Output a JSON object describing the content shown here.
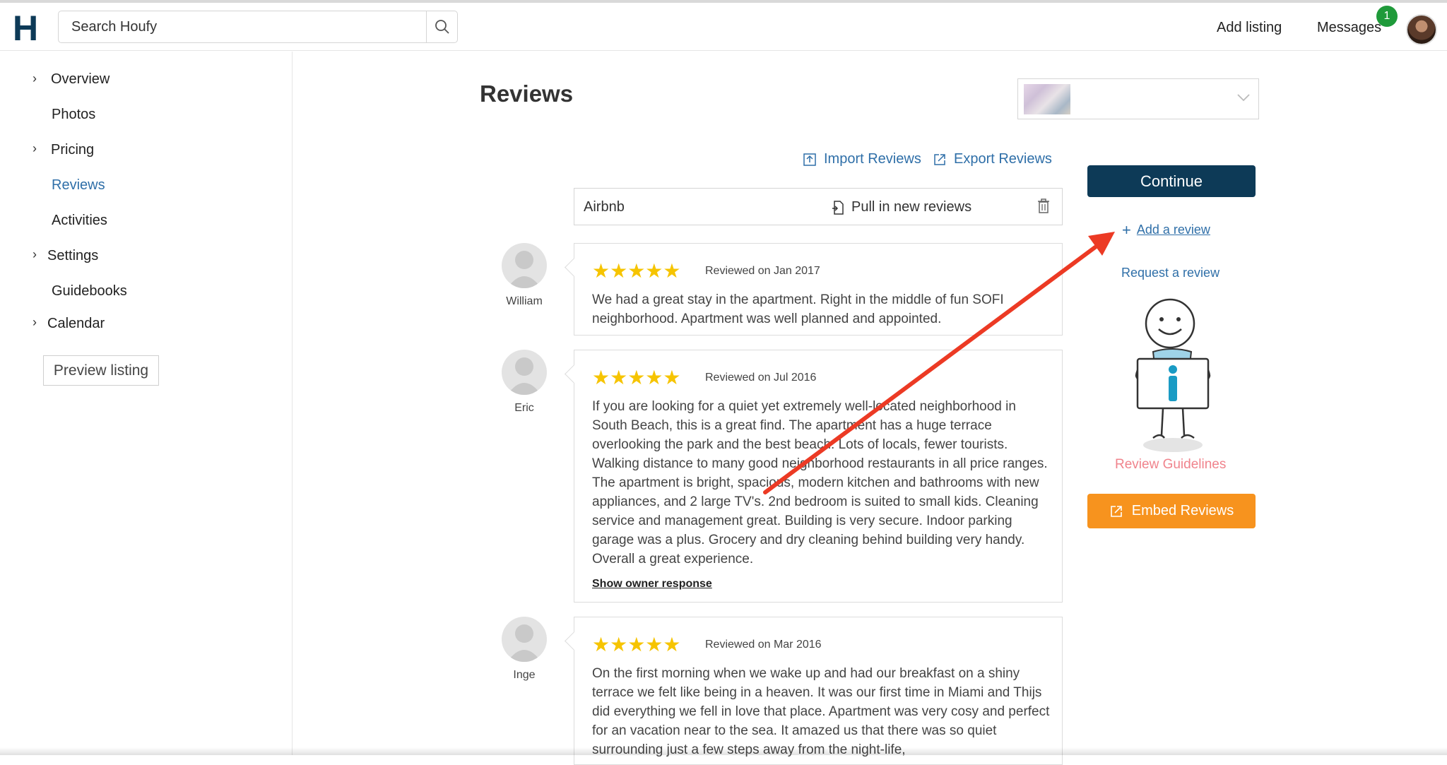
{
  "header": {
    "logo": "H",
    "search_placeholder": "Search Houfy",
    "add_listing": "Add listing",
    "messages": "Messages",
    "messages_badge": "1"
  },
  "sidebar": {
    "items": [
      {
        "label": "Overview",
        "chevron": true
      },
      {
        "label": "Photos",
        "chevron": false
      },
      {
        "label": "Pricing",
        "chevron": true
      },
      {
        "label": "Reviews",
        "chevron": false,
        "active": true
      },
      {
        "label": "Activities",
        "chevron": false
      },
      {
        "label": "Settings",
        "chevron": true
      },
      {
        "label": "Guidebooks",
        "chevron": false
      },
      {
        "label": "Calendar",
        "chevron": true
      }
    ],
    "preview_button": "Preview listing"
  },
  "main": {
    "title": "Reviews",
    "import_reviews": "Import Reviews",
    "export_reviews": "Export Reviews",
    "source": {
      "name": "Airbnb",
      "pull_label": "Pull in new reviews"
    },
    "reviews": [
      {
        "reviewer": "William",
        "stars": "★★★★★",
        "date": "Reviewed on Jan 2017",
        "text": "We had a great stay in the apartment. Right in the middle of fun SOFI neighborhood. Apartment was well planned and appointed."
      },
      {
        "reviewer": "Eric",
        "stars": "★★★★★",
        "date": "Reviewed on Jul 2016",
        "text": "If you are looking for a quiet yet extremely well-located neighborhood in South Beach, this is a great find. The apartment has a huge terrace overlooking the park and the best beach. Lots of locals, fewer tourists. Walking distance to many good neighborhood restaurants in all price ranges. The apartment is bright, spacious, modern kitchen and bathrooms with new appliances, and 2 large TV's. 2nd bedroom is suited to small kids. Cleaning service and management great. Building is very secure. Indoor parking garage was a plus. Grocery and dry cleaning behind building very handy. Overall a great experience.",
        "owner_response_link": "Show owner response"
      },
      {
        "reviewer": "Inge",
        "stars": "★★★★★",
        "date": "Reviewed on Mar 2016",
        "text": "On the first morning when we wake up and had our breakfast on a shiny terrace we felt like being in a heaven. It was our first time in Miami and Thijs did everything we fell in love that place. Apartment was very cosy and perfect for an vacation near to the sea. It amazed us that there was so quiet surrounding just a few steps away from the night-life,"
      }
    ]
  },
  "right_panel": {
    "continue": "Continue",
    "add_review": "Add a review",
    "request_review": "Request a review",
    "guidelines": "Review Guidelines",
    "embed": "Embed Reviews"
  },
  "colors": {
    "brand_dark": "#0d3a57",
    "link_blue": "#2f6fa8",
    "star_yellow": "#f6c400",
    "embed_orange": "#f7931e",
    "guidelines_pink": "#f0838c",
    "annotation_arrow": "#ec3a24"
  },
  "icons": [
    "search-icon",
    "chevron-right-icon",
    "chevron-down-icon",
    "import-icon",
    "export-icon",
    "pull-file-icon",
    "trash-icon",
    "plus-icon",
    "external-link-icon",
    "user-silhouette-icon"
  ]
}
